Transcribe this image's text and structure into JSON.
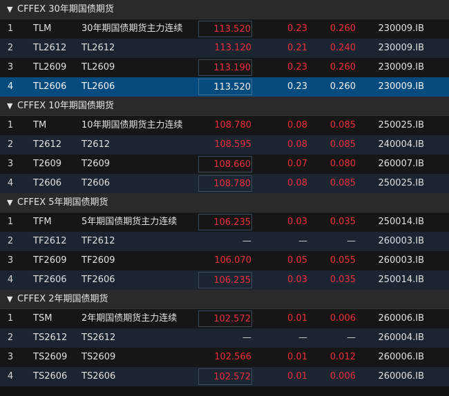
{
  "groups": [
    {
      "title": "CFFEX 30年期国债期货",
      "rows": [
        {
          "idx": "1",
          "code": "TLM",
          "name": "30年期国债期货主力连续",
          "price": "113.520",
          "change": "0.23",
          "pct": "0.260",
          "bond": "230009.IB",
          "dir": "up",
          "boxed": true,
          "selected": false
        },
        {
          "idx": "2",
          "code": "TL2612",
          "name": "TL2612",
          "price": "113.120",
          "change": "0.21",
          "pct": "0.240",
          "bond": "230009.IB",
          "dir": "up",
          "boxed": false,
          "selected": false
        },
        {
          "idx": "3",
          "code": "TL2609",
          "name": "TL2609",
          "price": "113.190",
          "change": "0.23",
          "pct": "0.260",
          "bond": "230009.IB",
          "dir": "up",
          "boxed": true,
          "selected": false
        },
        {
          "idx": "4",
          "code": "TL2606",
          "name": "TL2606",
          "price": "113.520",
          "change": "0.23",
          "pct": "0.260",
          "bond": "230009.IB",
          "dir": "up",
          "boxed": true,
          "selected": true
        }
      ]
    },
    {
      "title": "CFFEX 10年期国债期货",
      "rows": [
        {
          "idx": "1",
          "code": "TM",
          "name": "10年期国债期货主力连续",
          "price": "108.780",
          "change": "0.08",
          "pct": "0.085",
          "bond": "250025.IB",
          "dir": "up",
          "boxed": false,
          "selected": false
        },
        {
          "idx": "2",
          "code": "T2612",
          "name": "T2612",
          "price": "108.595",
          "change": "0.08",
          "pct": "0.085",
          "bond": "240004.IB",
          "dir": "up",
          "boxed": false,
          "selected": false
        },
        {
          "idx": "3",
          "code": "T2609",
          "name": "T2609",
          "price": "108.660",
          "change": "0.07",
          "pct": "0.080",
          "bond": "260007.IB",
          "dir": "up",
          "boxed": true,
          "selected": false
        },
        {
          "idx": "4",
          "code": "T2606",
          "name": "T2606",
          "price": "108.780",
          "change": "0.08",
          "pct": "0.085",
          "bond": "250025.IB",
          "dir": "up",
          "boxed": true,
          "selected": false
        }
      ]
    },
    {
      "title": "CFFEX 5年期国债期货",
      "rows": [
        {
          "idx": "1",
          "code": "TFM",
          "name": "5年期国债期货主力连续",
          "price": "106.235",
          "change": "0.03",
          "pct": "0.035",
          "bond": "250014.IB",
          "dir": "up",
          "boxed": true,
          "selected": false
        },
        {
          "idx": "2",
          "code": "TF2612",
          "name": "TF2612",
          "price": "—",
          "change": "—",
          "pct": "—",
          "bond": "260003.IB",
          "dir": "flat",
          "boxed": false,
          "selected": false
        },
        {
          "idx": "3",
          "code": "TF2609",
          "name": "TF2609",
          "price": "106.070",
          "change": "0.05",
          "pct": "0.055",
          "bond": "260003.IB",
          "dir": "up",
          "boxed": false,
          "selected": false
        },
        {
          "idx": "4",
          "code": "TF2606",
          "name": "TF2606",
          "price": "106.235",
          "change": "0.03",
          "pct": "0.035",
          "bond": "250014.IB",
          "dir": "up",
          "boxed": true,
          "selected": false
        }
      ]
    },
    {
      "title": "CFFEX 2年期国债期货",
      "rows": [
        {
          "idx": "1",
          "code": "TSM",
          "name": "2年期国债期货主力连续",
          "price": "102.572",
          "change": "0.01",
          "pct": "0.006",
          "bond": "260006.IB",
          "dir": "up",
          "boxed": true,
          "selected": false
        },
        {
          "idx": "2",
          "code": "TS2612",
          "name": "TS2612",
          "price": "—",
          "change": "—",
          "pct": "—",
          "bond": "260004.IB",
          "dir": "flat",
          "boxed": false,
          "selected": false
        },
        {
          "idx": "3",
          "code": "TS2609",
          "name": "TS2609",
          "price": "102.566",
          "change": "0.01",
          "pct": "0.012",
          "bond": "260006.IB",
          "dir": "up",
          "boxed": false,
          "selected": false
        },
        {
          "idx": "4",
          "code": "TS2606",
          "name": "TS2606",
          "price": "102.572",
          "change": "0.01",
          "pct": "0.006",
          "bond": "260006.IB",
          "dir": "up",
          "boxed": true,
          "selected": false
        }
      ]
    }
  ],
  "icons": {
    "group_caret": "caret-down-icon"
  },
  "colors": {
    "up": "#ee2f3f",
    "selected_row": "#054b7e",
    "group_header": "#2a2a2c",
    "row_alt": "#1b2431"
  }
}
